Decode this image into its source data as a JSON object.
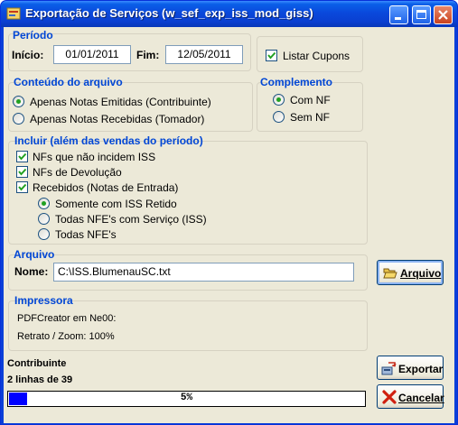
{
  "window": {
    "title": "Exportação de Serviços (w_sef_exp_iss_mod_giss)"
  },
  "periodo": {
    "title": "Período",
    "inicio_label": "Início:",
    "inicio_value": "01/01/2011",
    "fim_label": "Fim:",
    "fim_value": "12/05/2011",
    "listar_cupons_label": "Listar Cupons",
    "listar_cupons_checked": true
  },
  "conteudo": {
    "title": "Conteúdo do arquivo",
    "options": [
      {
        "label": "Apenas Notas Emitidas (Contribuinte)",
        "selected": true
      },
      {
        "label": "Apenas Notas Recebidas (Tomador)",
        "selected": false
      }
    ]
  },
  "complemento": {
    "title": "Complemento",
    "options": [
      {
        "label": "Com NF",
        "selected": true
      },
      {
        "label": "Sem NF",
        "selected": false
      }
    ]
  },
  "incluir": {
    "title": "Incluir (além das vendas do período)",
    "checks": [
      {
        "label": "NFs que não incidem ISS",
        "checked": true
      },
      {
        "label": "NFs de Devolução",
        "checked": true
      },
      {
        "label": "Recebidos (Notas de Entrada)",
        "checked": true
      }
    ],
    "radios": [
      {
        "label": "Somente com ISS Retido",
        "selected": true
      },
      {
        "label": "Todas NFE's com Serviço (ISS)",
        "selected": false
      },
      {
        "label": "Todas NFE's",
        "selected": false
      }
    ]
  },
  "arquivo": {
    "title": "Arquivo",
    "nome_label": "Nome:",
    "nome_value": "C:\\ISS.BlumenauSC.txt",
    "button_label": "Arquivo"
  },
  "impressora": {
    "title": "Impressora",
    "printer": "PDFCreator em Ne00:",
    "orientation": "Retrato / Zoom: 100%"
  },
  "status": {
    "title": "Contribuinte",
    "lines": "2 linhas de 39",
    "progress_text": "5%",
    "progress_fraction": 0.05
  },
  "buttons": {
    "exportar": "Exportar",
    "cancelar": "Cancelar"
  },
  "colors": {
    "group_title": "#0046d5",
    "progress_fill": "#0000ff",
    "face": "#ece9d8"
  }
}
